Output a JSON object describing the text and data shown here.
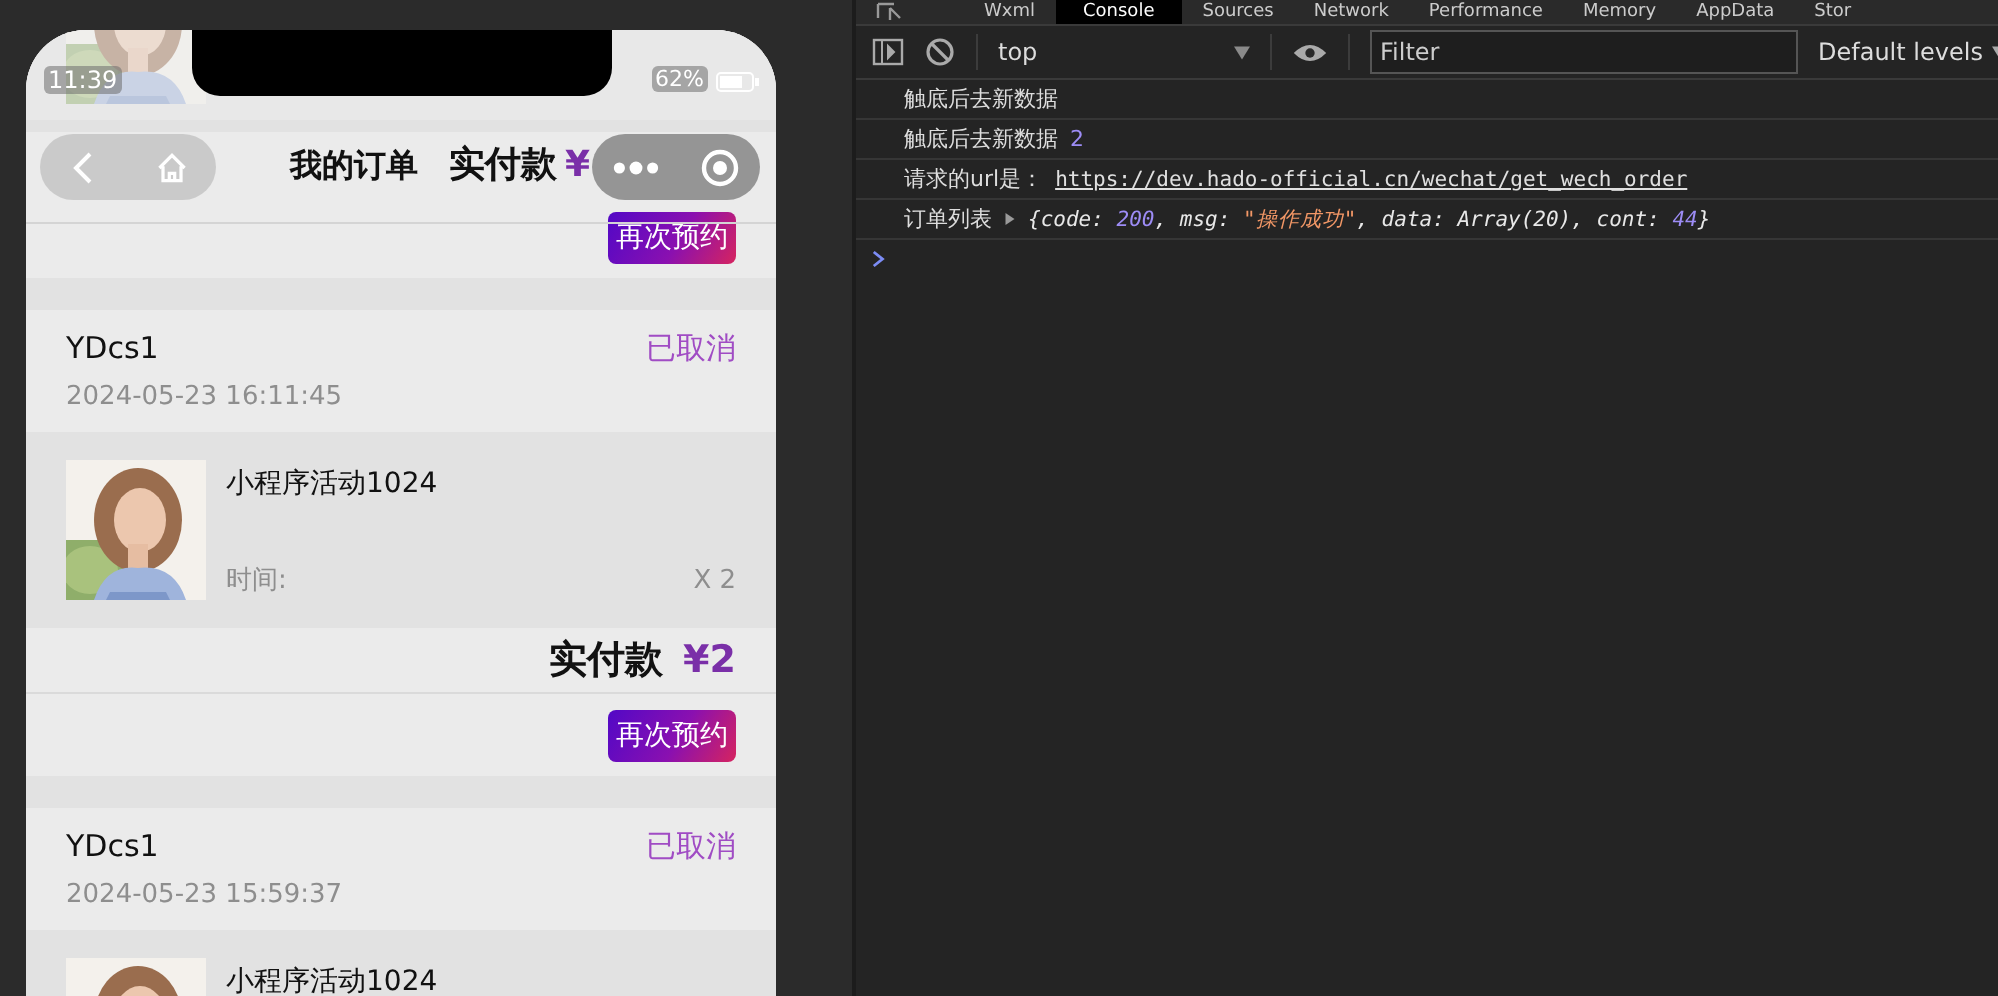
{
  "phone": {
    "status_bar": {
      "time": "11:39",
      "battery": "62%"
    },
    "nav": {
      "title": "我的订单"
    },
    "orders": [
      {
        "total_label": "实付款",
        "amount": "¥",
        "button": "再次预约"
      },
      {
        "name": "YDcs1",
        "status": "已取消",
        "date": "2024-05-23 16:11:45",
        "item": {
          "kind": "picture",
          "title": "小程序活动1024",
          "time_label": "时间:",
          "qty": "X 2"
        },
        "total_label": "实付款",
        "amount": "¥2",
        "button": "再次预约"
      },
      {
        "name": "YDcs1",
        "status": "已取消",
        "date": "2024-05-23 15:59:37",
        "item": {
          "kind": "picture",
          "title": "小程序活动1024"
        }
      }
    ]
  },
  "devtools": {
    "tabs": [
      {
        "label": "Wxml",
        "selected": false
      },
      {
        "label": "Console",
        "selected": true
      },
      {
        "label": "Sources",
        "selected": false
      },
      {
        "label": "Network",
        "selected": false
      },
      {
        "label": "Performance",
        "selected": false
      },
      {
        "label": "Memory",
        "selected": false
      },
      {
        "label": "AppData",
        "selected": false
      },
      {
        "label": "Stor",
        "selected": false
      }
    ],
    "toolbar": {
      "context": "top",
      "filter": {
        "placeholder": "Filter"
      },
      "levels": "Default levels"
    },
    "log": [
      {
        "message": "触底后去新数据"
      },
      {
        "message": "触底后去新数据",
        "value": {
          "kind": "number",
          "text": "2"
        }
      },
      {
        "message": "请求的url是：",
        "value": {
          "kind": "url",
          "text": "https://dev.hado-official.cn/wechat/get_wech_order"
        }
      },
      {
        "message": "订单列表",
        "value": {
          "kind": "object",
          "expanded": false,
          "parts": [
            {
              "kind": "plain",
              "text": "{code: "
            },
            {
              "kind": "number",
              "text": "200"
            },
            {
              "kind": "plain",
              "text": ", msg: "
            },
            {
              "kind": "string",
              "text": "\"操作成功\""
            },
            {
              "kind": "plain",
              "text": ", data: Array(20), cont: "
            },
            {
              "kind": "number",
              "text": "44"
            },
            {
              "kind": "plain",
              "text": "}"
            }
          ]
        }
      }
    ]
  }
}
